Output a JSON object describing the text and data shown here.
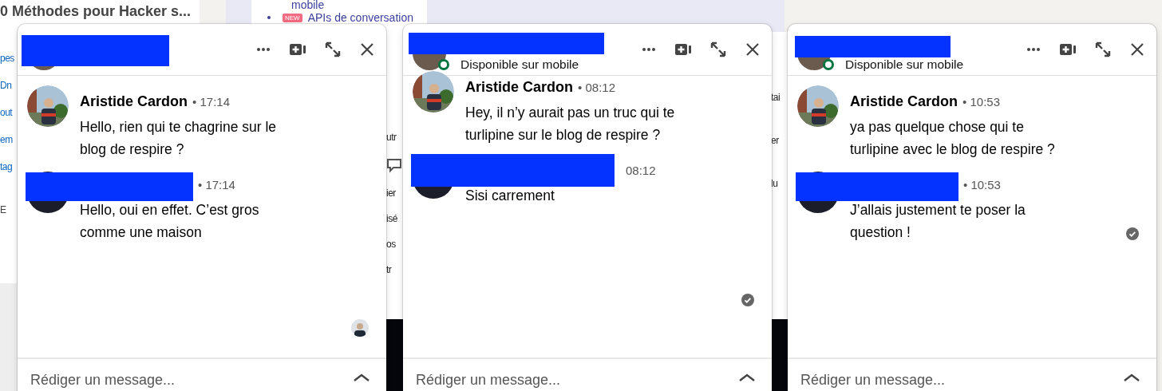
{
  "background": {
    "article_title": "0 Méthodes pour Hacker s...",
    "card_items": [
      {
        "text": "mobile"
      },
      {
        "text": "APIs de conversation",
        "badge": "NEW"
      }
    ],
    "strips": [
      {
        "fragments": [
          "pes",
          "Dn",
          "out",
          "em",
          "tag",
          "E"
        ]
      },
      {
        "fragments": [
          "utr",
          "ier",
          "isé",
          "os",
          "tr"
        ]
      },
      {
        "fragments": [
          "tai",
          "er",
          "lu"
        ]
      }
    ]
  },
  "chats": [
    {
      "online": false,
      "messages": [
        {
          "author": "Aristide Cardon",
          "time": "• 17:14",
          "text": "Hello, rien qui te chagrine sur le blog de respire ?"
        },
        {
          "time": "• 17:14",
          "text": "Hello, oui en effet. C’est gros comme une maison"
        }
      ],
      "receipt": {
        "kind": "avatar"
      },
      "composer": {
        "placeholder": "Rédiger un message..."
      }
    },
    {
      "status": "Disponible sur mobile",
      "online": true,
      "messages": [
        {
          "author": "Aristide Cardon",
          "time": "• 08:12",
          "text": "Hey, il n’y aurait pas un truc qui te turlipine sur le blog de respire ?"
        },
        {
          "time": "08:12",
          "text": "Sisi carrement"
        }
      ],
      "receipt": {
        "kind": "check"
      },
      "composer": {
        "placeholder": "Rédiger un message..."
      }
    },
    {
      "status": "Disponible sur mobile",
      "online": true,
      "messages": [
        {
          "author": "Aristide Cardon",
          "time": "• 10:53",
          "text": "ya pas quelque chose qui te turlipine avec le blog de respire ?"
        },
        {
          "time": "• 10:53",
          "text": "J’allais justement te poser la question !"
        }
      ],
      "receipt": {
        "kind": "check"
      },
      "composer": {
        "placeholder": "Rédiger un message..."
      }
    }
  ]
}
